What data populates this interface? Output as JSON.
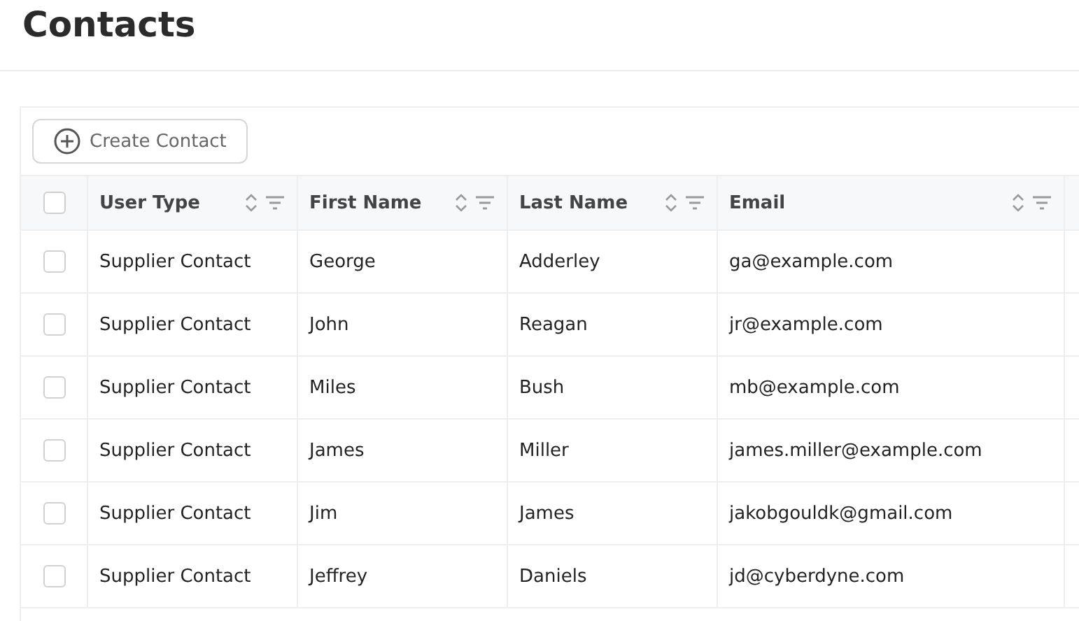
{
  "page": {
    "title": "Contacts"
  },
  "toolbar": {
    "create_button": "Create Contact"
  },
  "table": {
    "select_all": {
      "checked": false
    },
    "columns": [
      {
        "label": "User Type"
      },
      {
        "label": "First Name"
      },
      {
        "label": "Last Name"
      },
      {
        "label": "Email"
      }
    ],
    "rows": [
      {
        "checked": false,
        "cells": [
          "Supplier Contact",
          "George",
          "Adderley",
          "ga@example.com"
        ]
      },
      {
        "checked": false,
        "cells": [
          "Supplier Contact",
          "John",
          "Reagan",
          "jr@example.com"
        ]
      },
      {
        "checked": false,
        "cells": [
          "Supplier Contact",
          "Miles",
          "Bush",
          "mb@example.com"
        ]
      },
      {
        "checked": false,
        "cells": [
          "Supplier Contact",
          "James",
          "Miller",
          "james.miller@example.com"
        ]
      },
      {
        "checked": false,
        "cells": [
          "Supplier Contact",
          "Jim",
          "James",
          "jakobgouldk@gmail.com"
        ]
      },
      {
        "checked": false,
        "cells": [
          "Supplier Contact",
          "Jeffrey",
          "Daniels",
          "jd@cyberdyne.com"
        ]
      }
    ]
  }
}
